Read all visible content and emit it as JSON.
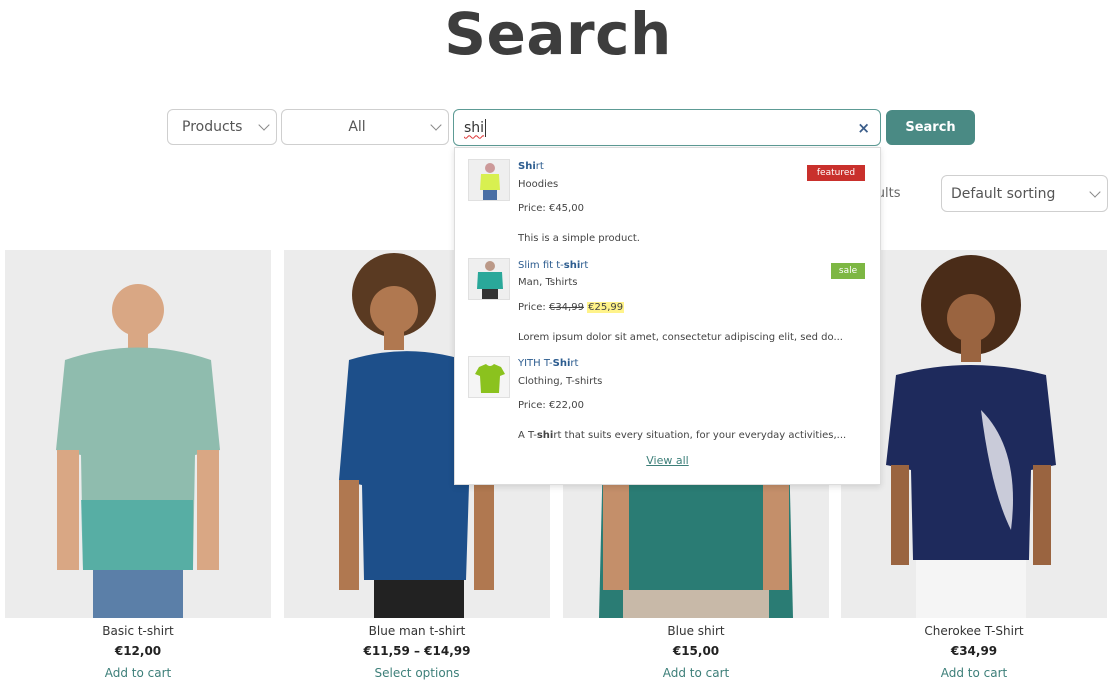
{
  "page_title": "Search",
  "search_bar": {
    "type_select": "Products",
    "category_select": "All",
    "query": "shi",
    "clear_icon": "×",
    "button": "Search"
  },
  "results_text": "sults",
  "sort_select": "Default sorting",
  "suggestions": [
    {
      "title_bold": "Shi",
      "title_rest": "rt",
      "category": "Hoodies",
      "price_label": "Price: ",
      "price": "€45,00",
      "description": "This is a simple product.",
      "badge": "featured",
      "badge_color": "#c9302c"
    },
    {
      "title_prefix": "Slim fit t-",
      "title_bold": "shi",
      "title_rest": "rt",
      "category": "Man, Tshirts",
      "price_label": "Price: ",
      "old_price": "€34,99",
      "price": "€25,99",
      "description": "Lorem ipsum dolor sit amet, consectetur adipiscing elit, sed do...",
      "badge": "sale",
      "badge_color": "#7db743"
    },
    {
      "title_prefix": "YITH T-",
      "title_bold": "Shi",
      "title_rest": "rt",
      "category": "Clothing, T-shirts",
      "price_label": "Price: ",
      "price": "€22,00",
      "desc_prefix": "A T-",
      "desc_bold": "shi",
      "desc_rest": "rt that suits every situation, for your everyday activities,..."
    }
  ],
  "view_all": "View all",
  "products": [
    {
      "name": "Basic t-shirt",
      "price": "€12,00",
      "cta": "Add to cart",
      "shirt_color": "#8fbcae"
    },
    {
      "name": "Blue man t-shirt",
      "price": "€11,59 – €14,99",
      "cta": "Select options",
      "shirt_color": "#1d4f8a"
    },
    {
      "name": "Blue shirt",
      "price": "€15,00",
      "cta": "Add to cart",
      "shirt_color": "#2a7c74"
    },
    {
      "name": "Cherokee T-Shirt",
      "price": "€34,99",
      "cta": "Add to cart",
      "shirt_color": "#1e2a5c"
    }
  ],
  "colors": {
    "accent": "#4a8a84",
    "link": "#2c5c8f",
    "sale": "#7db743",
    "featured": "#c9302c"
  }
}
